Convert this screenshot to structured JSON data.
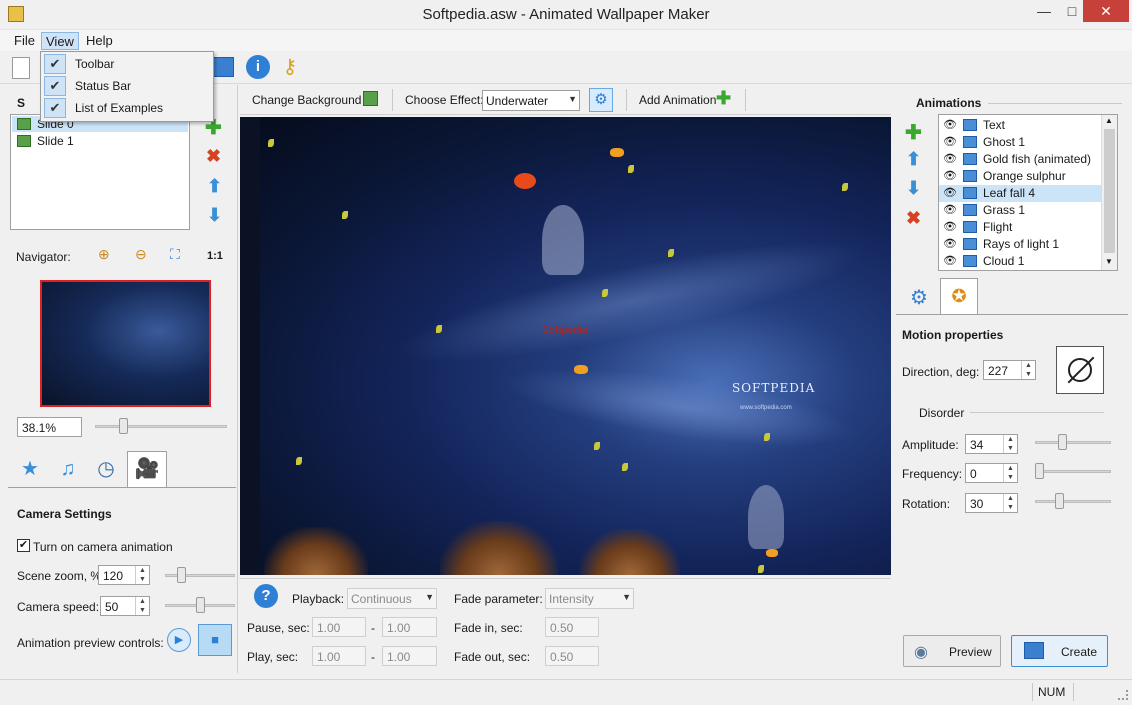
{
  "window": {
    "title": "Softpedia.asw - Animated Wallpaper Maker",
    "minimize": "—",
    "maximize": "□",
    "close": "✕"
  },
  "menu": {
    "file": "File",
    "view": "View",
    "help": "Help"
  },
  "view_menu": {
    "items": [
      {
        "label": "Toolbar",
        "check": "✔"
      },
      {
        "label": "Status Bar",
        "check": "✔"
      },
      {
        "label": "List of Examples",
        "check": "✔"
      }
    ]
  },
  "slides": {
    "header": "S",
    "items": [
      "Slide 0",
      "Slide 1"
    ]
  },
  "navigator": {
    "label": "Navigator:",
    "one_to_one": "1:1",
    "zoom": "38.1%"
  },
  "effect_bar": {
    "change_background": "Change Background",
    "choose_effect_label": "Choose Effect:",
    "effect_value": "Underwater",
    "add_animation": "Add Animation"
  },
  "camera": {
    "title": "Camera Settings",
    "turn_on_label": "Turn on camera animation",
    "turn_on_checked": "✔",
    "scene_zoom_label": "Scene zoom, %:",
    "scene_zoom": "120",
    "camera_speed_label": "Camera speed:",
    "camera_speed": "50",
    "preview_controls_label": "Animation preview controls:"
  },
  "playback": {
    "playback_label": "Playback:",
    "playback_value": "Continuous",
    "pause_label": "Pause, sec:",
    "pause_from": "1.00",
    "pause_to": "1.00",
    "play_label": "Play, sec:",
    "play_from": "1.00",
    "play_to": "1.00",
    "dash": "-",
    "fade_param_label": "Fade parameter:",
    "fade_param_value": "Intensity",
    "fade_in_label": "Fade in, sec:",
    "fade_in": "0.50",
    "fade_out_label": "Fade out, sec:",
    "fade_out": "0.50"
  },
  "animations": {
    "title": "Animations",
    "items": [
      "Text",
      "Ghost 1",
      "Gold fish (animated)",
      "Orange sulphur",
      "Leaf fall 4",
      "Grass 1",
      "Flight",
      "Rays of light 1",
      "Cloud 1"
    ],
    "selected_index": 4
  },
  "motion": {
    "title": "Motion properties",
    "direction_label": "Direction, deg:",
    "direction": "227",
    "disorder_label": "Disorder",
    "amplitude_label": "Amplitude:",
    "amplitude": "34",
    "frequency_label": "Frequency:",
    "frequency": "0",
    "rotation_label": "Rotation:",
    "rotation": "30"
  },
  "actions": {
    "preview": "Preview",
    "create": "Create"
  },
  "canvas_text": {
    "brand": "SOFTPEDIA",
    "url": "www.softpedia.com",
    "watermark": "Softpedia"
  },
  "status": {
    "num": "NUM"
  },
  "colors": {
    "selection": "#cce4f7",
    "accent_blue": "#3a8fd6",
    "add_green": "#3aa82e",
    "delete_red": "#d64322",
    "canvas_bg": "#0b1224"
  }
}
